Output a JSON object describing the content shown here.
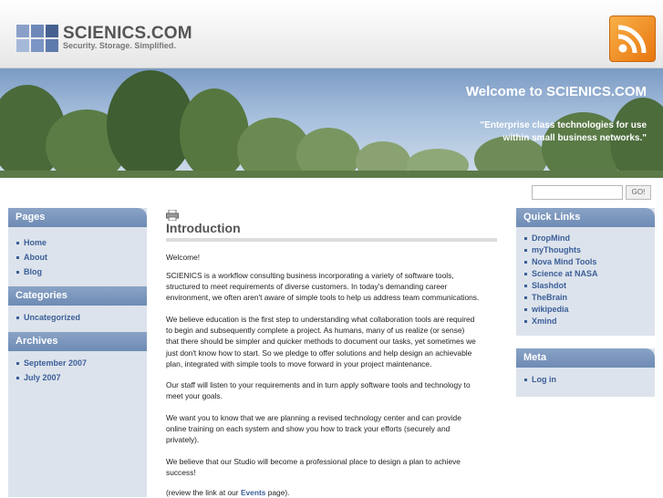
{
  "header": {
    "site_title": "SCIENICS.COM",
    "tagline": "Security. Storage. Simplified.",
    "logo_colors": [
      "#7b95c4",
      "#5f7aac",
      "#3f5a8a",
      "#9aafd4"
    ]
  },
  "banner": {
    "title": "Welcome to SCIENICS.COM",
    "quote_line1": "\"Enterprise class technologies for use",
    "quote_line2": "within small business networks.\""
  },
  "search": {
    "value": "",
    "button_label": "GO!"
  },
  "left_sidebar": {
    "pages": {
      "heading": "Pages",
      "items": [
        {
          "label": "Home"
        },
        {
          "label": "About"
        },
        {
          "label": "Blog"
        }
      ]
    },
    "categories": {
      "heading": "Categories",
      "items": [
        {
          "label": "Uncategorized"
        }
      ]
    },
    "archives": {
      "heading": "Archives",
      "items": [
        {
          "label": "September 2007"
        },
        {
          "label": "July 2007"
        }
      ]
    }
  },
  "main": {
    "title": "Introduction",
    "paragraphs": [
      {
        "text": "Welcome!"
      },
      {
        "lines": [
          "SCIENICS is a workflow consulting business incorporating a variety of software tools,",
          "structured to meet requirements of diverse customers. In today's demanding career",
          "environment, we often aren't aware of simple tools to help us address team communications."
        ]
      },
      {
        "lines": [
          "We believe education is the first step to understanding what collaboration tools are required",
          "to begin and subsequently complete a project.  As humans, many of us realize (or sense)",
          "that there should be simpler and quicker methods to document our tasks, yet sometimes we",
          "just don't know how to start.  So we pledge to offer solutions and help design an achievable",
          "plan, integrated with simple tools to move forward in your project maintenance."
        ]
      },
      {
        "lines": [
          "Our staff will listen to your requirements and in turn apply software tools and technology to",
          "meet your goals."
        ]
      },
      {
        "lines": [
          "We want you to know that we are planning a revised technology center and can provide",
          "online training on each system and show you how to track your efforts (securely and",
          "privately)."
        ]
      },
      {
        "lines": [
          "We believe that our Studio will become a professional place to design a plan to achieve",
          "success!"
        ]
      },
      {
        "before": "(review the link at our ",
        "link": "Events",
        "after": " page)."
      }
    ]
  },
  "right_sidebar": {
    "quick_links": {
      "heading": "Quick Links",
      "items": [
        {
          "label": "DropMind"
        },
        {
          "label": "myThoughts"
        },
        {
          "label": "Nova Mind Tools"
        },
        {
          "label": "Science at NASA"
        },
        {
          "label": "Slashdot"
        },
        {
          "label": "TheBrain"
        },
        {
          "label": "wikipedia"
        },
        {
          "label": "Xmind"
        }
      ]
    },
    "meta": {
      "heading": "Meta",
      "items": [
        {
          "label": "Log in"
        }
      ]
    }
  },
  "icons": {
    "rss": "rss-feed-icon",
    "print": "print-icon"
  },
  "colors": {
    "link": "#3b5f99",
    "sidebar_heading": "#7a96bd",
    "sidebar_bg": "#dde3ec",
    "rss_orange": "#f0901e"
  }
}
